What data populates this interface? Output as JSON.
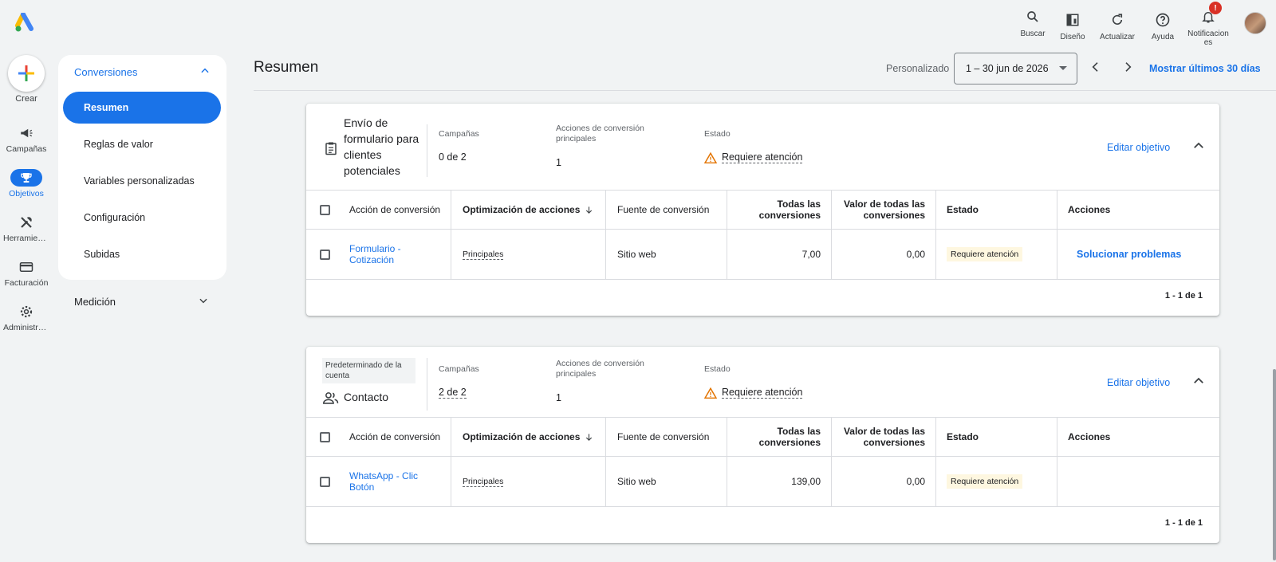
{
  "topbar": {
    "actions": [
      {
        "icon": "search-icon",
        "label": "Buscar"
      },
      {
        "icon": "layout-icon",
        "label": "Diseño"
      },
      {
        "icon": "refresh-icon",
        "label": "Actualizar"
      },
      {
        "icon": "help-icon",
        "label": "Ayuda"
      },
      {
        "icon": "bell-icon",
        "label": "Notificaciones"
      }
    ],
    "notifications_label_line1": "Notificacion",
    "notifications_label_line2": "es",
    "notification_badge": "!"
  },
  "rail": {
    "create_label": "Crear",
    "items": [
      {
        "icon": "megaphone-icon",
        "label": "Campañas"
      },
      {
        "icon": "trophy-icon",
        "label": "Objetivos",
        "active": true
      },
      {
        "icon": "tools-icon",
        "label": "Herramientas"
      },
      {
        "icon": "credit-card-icon",
        "label": "Facturación"
      },
      {
        "icon": "gear-icon",
        "label": "Administrador"
      }
    ]
  },
  "subnav": {
    "section": "Conversiones",
    "items": [
      "Resumen",
      "Reglas de valor",
      "Variables personalizadas",
      "Configuración",
      "Subidas"
    ],
    "active": "Resumen",
    "collapsed_section": "Medición"
  },
  "header": {
    "title": "Resumen",
    "date_mode": "Personalizado",
    "date_range": "1 – 30 jun de 2026",
    "show_last_30": "Mostrar últimos 30 días"
  },
  "colors": {
    "accent": "#1a73e8",
    "warning": "#e37400",
    "warning_chip_bg": "#fef7e0"
  },
  "table_headers": {
    "conversion_action": "Acción de conversión",
    "action_optimization": "Optimización de acciones",
    "conversion_source": "Fuente de conversión",
    "all_conversions": "Todas las conversiones",
    "all_conversions_value": "Valor de todas las conversiones",
    "status": "Estado",
    "actions": "Acciones"
  },
  "goals": [
    {
      "name": "Envío de formulario para clientes potenciales",
      "campaigns_label": "Campañas",
      "campaigns_value": "0 de 2",
      "primary_label": "Acciones de conversión principales",
      "primary_value": "1",
      "status_label": "Estado",
      "status_value": "Requiere atención",
      "edit_label": "Editar objetivo",
      "rows": [
        {
          "action": "Formulario - Cotización",
          "optimization": "Principales",
          "source": "Sitio web",
          "all_conv": "7,00",
          "all_conv_value": "0,00",
          "status": "Requiere atención",
          "actions": "Solucionar problemas"
        }
      ],
      "pagination": "1 - 1 de 1"
    },
    {
      "chip": "Predeterminado de la cuenta",
      "name": "Contacto",
      "campaigns_label": "Campañas",
      "campaigns_value": "2 de 2",
      "primary_label": "Acciones de conversión principales",
      "primary_value": "1",
      "status_label": "Estado",
      "status_value": "Requiere atención",
      "edit_label": "Editar objetivo",
      "rows": [
        {
          "action": "WhatsApp - Clic Botón",
          "optimization": "Principales",
          "source": "Sitio web",
          "all_conv": "139,00",
          "all_conv_value": "0,00",
          "status": "Requiere atención",
          "actions": ""
        }
      ],
      "pagination": "1 - 1 de 1"
    }
  ]
}
